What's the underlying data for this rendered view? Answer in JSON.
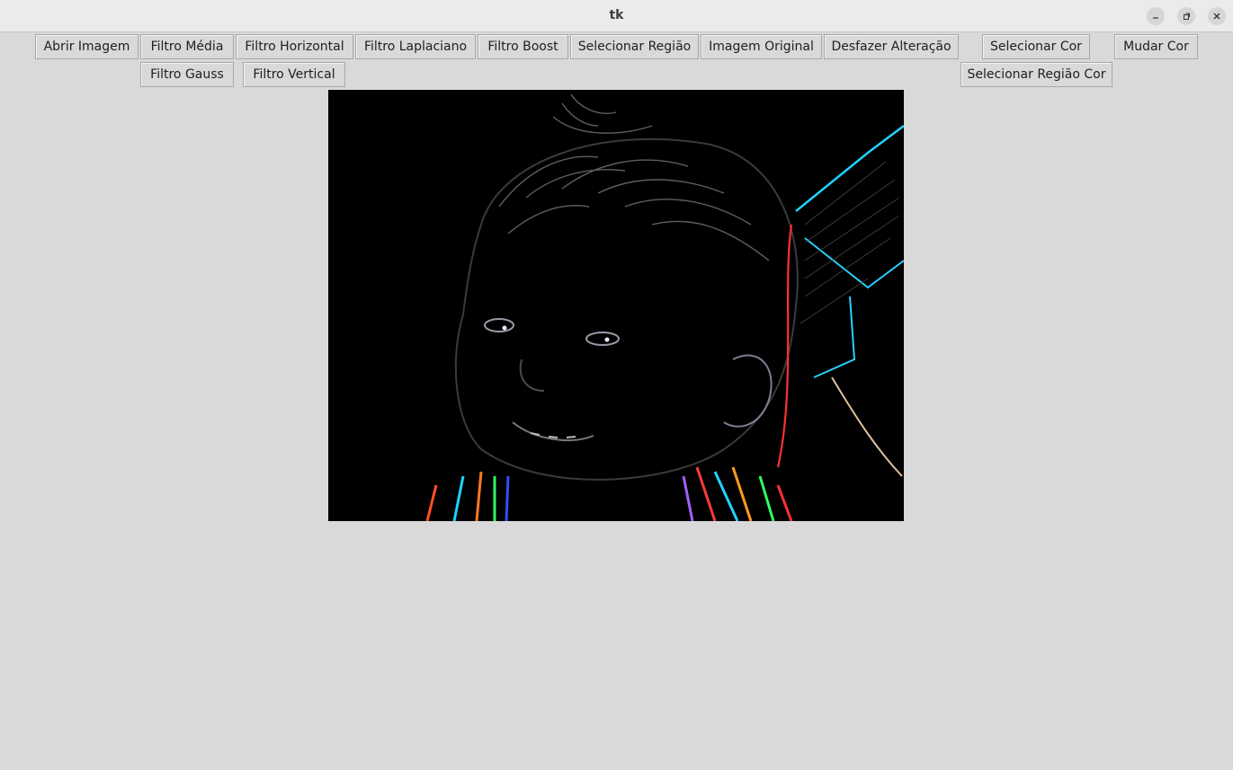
{
  "window": {
    "title": "tk"
  },
  "toolbar": {
    "row1": [
      {
        "label": "Abrir Imagem"
      },
      {
        "label": "Filtro Média"
      },
      {
        "label": "Filtro Horizontal"
      },
      {
        "label": "Filtro Laplaciano"
      },
      {
        "label": "Filtro Boost"
      },
      {
        "label": "Selecionar Região"
      },
      {
        "label": "Imagem Original"
      },
      {
        "label": "Desfazer Alteração"
      },
      {
        "label": "Selecionar Cor"
      },
      {
        "label": "Mudar Cor"
      }
    ],
    "row2": [
      {
        "label": "Filtro Gauss"
      },
      {
        "label": "Filtro Vertical"
      },
      {
        "label": "Selecionar Região Cor"
      }
    ]
  },
  "colors": {
    "background": "#d9d9d9",
    "titlebar": "#ebebeb",
    "canvas": "#000000"
  },
  "icons": [
    "minimize-icon",
    "maximize-icon",
    "close-icon"
  ]
}
